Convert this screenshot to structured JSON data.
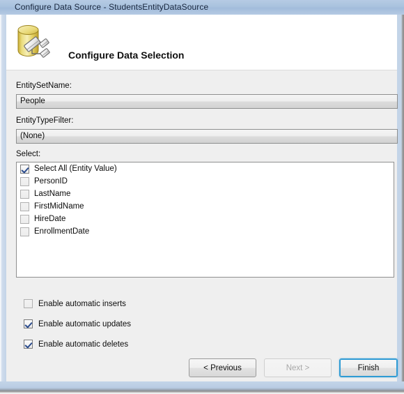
{
  "window": {
    "title": "Configure Data Source - StudentsEntityDataSource",
    "icon": "database-edit-icon"
  },
  "header": {
    "title": "Configure Data Selection",
    "icon": "database-edit-icon"
  },
  "form": {
    "entity_set_name": {
      "label": "EntitySetName:",
      "value": "People",
      "icon": "chevron-down-icon"
    },
    "entity_type_filter": {
      "label": "EntityTypeFilter:",
      "value": "(None)",
      "icon": "chevron-down-icon"
    },
    "select": {
      "label": "Select:",
      "items": [
        {
          "label": "Select All (Entity Value)",
          "checked": true,
          "disabled": false
        },
        {
          "label": "PersonID",
          "checked": false,
          "disabled": true
        },
        {
          "label": "LastName",
          "checked": false,
          "disabled": true
        },
        {
          "label": "FirstMidName",
          "checked": false,
          "disabled": true
        },
        {
          "label": "HireDate",
          "checked": false,
          "disabled": true
        },
        {
          "label": "EnrollmentDate",
          "checked": false,
          "disabled": true
        }
      ]
    },
    "options": [
      {
        "label": "Enable automatic inserts",
        "checked": false,
        "disabled": true
      },
      {
        "label": "Enable automatic updates",
        "checked": true,
        "disabled": false
      },
      {
        "label": "Enable automatic deletes",
        "checked": true,
        "disabled": false
      }
    ]
  },
  "buttons": {
    "previous": {
      "label": "< Previous",
      "disabled": false,
      "focused": false
    },
    "next": {
      "label": "Next >",
      "disabled": true,
      "focused": false
    },
    "finish": {
      "label": "Finish",
      "disabled": false,
      "focused": true
    }
  },
  "colors": {
    "titlebar": "#a9c2de",
    "frame": "#c3d4e8",
    "body": "#efefef",
    "focus_ring": "#2f9bd4",
    "checkmark": "#2a4b8d",
    "icon_gold": "#e8d45c"
  }
}
